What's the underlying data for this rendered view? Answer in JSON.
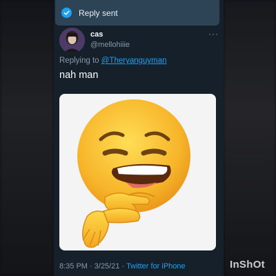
{
  "toast": {
    "icon": "check-circle-icon",
    "text": "Reply sent",
    "color": "#2d4456"
  },
  "tweet": {
    "author": {
      "name": "cas",
      "handle": "@mellohiiie",
      "avatar": "avatar-photo"
    },
    "more_icon": "ellipsis-icon",
    "more_text": "···",
    "replying_prefix": "Replying to",
    "replying_to": "@Theryanguyman",
    "text": "nah man",
    "media": {
      "icon": "face-with-hand-over-mouth-emoji"
    },
    "time": "8:35 PM",
    "separator": "·",
    "date": "3/25/21",
    "source": "Twitter for iPhone"
  },
  "watermark": "InShOt",
  "colors": {
    "background": "#15202b",
    "accent": "#1da1f2",
    "secondary_text": "#8899a6"
  }
}
